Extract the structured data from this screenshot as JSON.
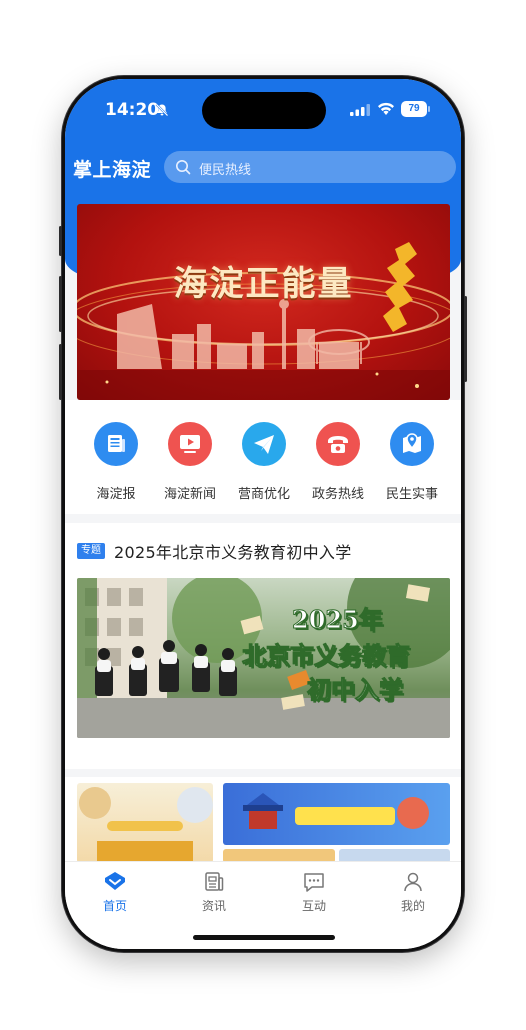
{
  "status_bar": {
    "time": "14:20",
    "battery": "79"
  },
  "header": {
    "app_title": "掌上海淀",
    "search_placeholder": "便民热线"
  },
  "banner": {
    "text": "海淀正能量"
  },
  "quick_nav": [
    {
      "label": "海淀报",
      "icon": "newspaper-icon",
      "color": "#2e8cf0"
    },
    {
      "label": "海淀新闻",
      "icon": "tv-icon",
      "color": "#ef5350"
    },
    {
      "label": "营商优化",
      "icon": "send-icon",
      "color": "#29a8ec"
    },
    {
      "label": "政务热线",
      "icon": "phone-icon",
      "color": "#ef5350"
    },
    {
      "label": "民生实事",
      "icon": "map-pin-icon",
      "color": "#2e8cf0"
    }
  ],
  "feature": {
    "tag": "专题",
    "title": "2025年北京市义务教育初中入学",
    "poster_lines": [
      "2025年",
      "北京市义务教育",
      "初中入学"
    ]
  },
  "tabs": [
    {
      "label": "首页",
      "icon": "home-icon",
      "active": true
    },
    {
      "label": "资讯",
      "icon": "news-icon",
      "active": false
    },
    {
      "label": "互动",
      "icon": "chat-icon",
      "active": false
    },
    {
      "label": "我的",
      "icon": "user-icon",
      "active": false
    }
  ],
  "colors": {
    "primary": "#1a73e8",
    "accent_red": "#ef5350"
  }
}
